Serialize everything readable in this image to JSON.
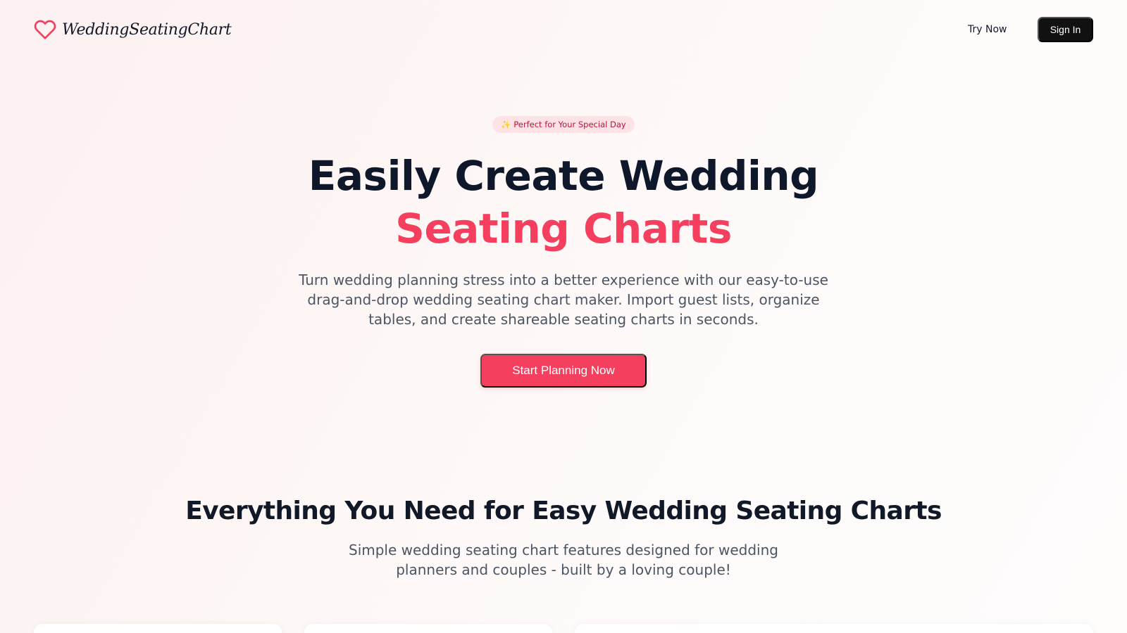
{
  "header": {
    "logo_text": "WeddingSeatingChart",
    "logo_icon": "heart-icon",
    "try_now_label": "Try Now",
    "sign_in_label": "Sign In"
  },
  "hero": {
    "badge": "✨ Perfect for Your Special Day",
    "title_line1": "Easily Create Wedding",
    "title_line2": "Seating Charts",
    "description": "Turn wedding planning stress into a better experience with our easy-to-use drag-and-drop wedding seating chart maker. Import guest lists, organize tables, and create shareable seating charts in seconds.",
    "cta_label": "Start Planning Now"
  },
  "features": {
    "title": "Everything You Need for Easy Wedding Seating Charts",
    "subtitle": "Simple wedding seating chart features designed for wedding planners and couples - built by a loving couple!"
  },
  "colors": {
    "accent": "#f43f5e",
    "dark": "#111111",
    "badge_bg": "#fde3e6"
  }
}
